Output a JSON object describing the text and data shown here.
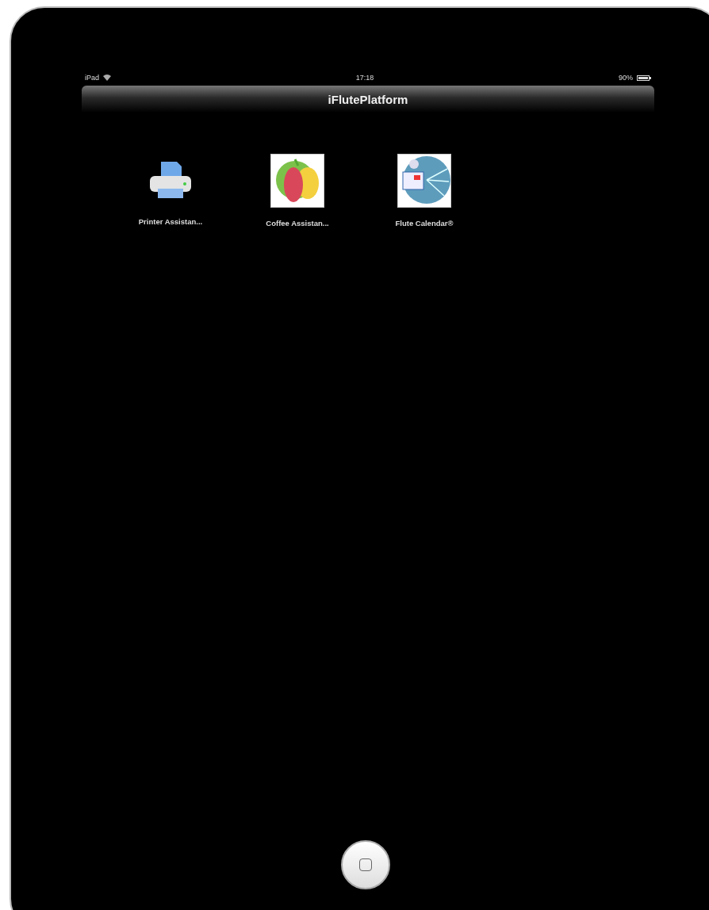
{
  "status_bar": {
    "carrier": "iPad",
    "time": "17:18",
    "battery": "90%"
  },
  "nav_bar": {
    "title": "iFlutePlatform"
  },
  "apps": [
    {
      "label": "Printer Assistan...",
      "kind": "printer"
    },
    {
      "label": "Coffee Assistan...",
      "kind": "fruit"
    },
    {
      "label": "Flute Calendar®",
      "kind": "calendar"
    }
  ]
}
